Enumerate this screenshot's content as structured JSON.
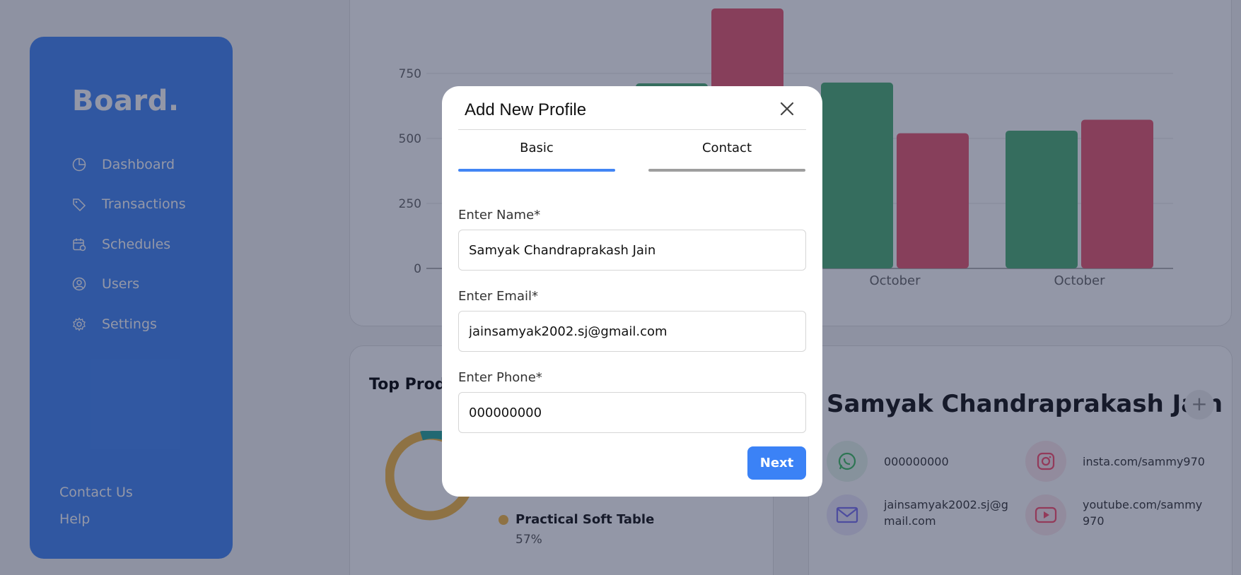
{
  "sidebar": {
    "logo": "Board.",
    "items": [
      {
        "label": "Dashboard",
        "icon": "pie-chart-icon"
      },
      {
        "label": "Transactions",
        "icon": "tag-icon"
      },
      {
        "label": "Schedules",
        "icon": "calendar-clock-icon"
      },
      {
        "label": "Users",
        "icon": "user-circle-icon"
      },
      {
        "label": "Settings",
        "icon": "gear-icon"
      }
    ],
    "footer": [
      "Contact Us",
      "Help"
    ]
  },
  "chart_data": {
    "type": "bar",
    "categories": [
      "",
      "October",
      "October"
    ],
    "series": [
      {
        "values": [
          712,
          715,
          530
        ],
        "color": "#4caf73"
      },
      {
        "values": [
          1000,
          520,
          572
        ],
        "color": "#e8576d"
      }
    ],
    "ylim": [
      0,
      1000
    ],
    "yticks": [
      0,
      250,
      500,
      750
    ]
  },
  "top_products": {
    "title": "Top Prod",
    "legend_name": "Practical Soft Table",
    "legend_pct": "57%"
  },
  "profile_card": {
    "name": "Samyak Chandraprakash Jain",
    "add_symbol": "+",
    "phone": "000000000",
    "email_line1": "jainsamyak2002.sj@g",
    "email_line2": "mail.com",
    "instagram": "insta.com/sammy970",
    "youtube_line1": "youtube.com/sammy",
    "youtube_line2": "970"
  },
  "modal": {
    "title": "Add New Profile",
    "tabs": {
      "basic": "Basic",
      "contact": "Contact"
    },
    "name_label": "Enter Name*",
    "name_value": "Samyak Chandraprakash Jain",
    "email_label": "Enter Email*",
    "email_value": "jainsamyak2002.sj@gmail.com",
    "phone_label": "Enter Phone*",
    "phone_value": "000000000",
    "next_label": "Next"
  },
  "colors": {
    "accent": "#4285f4",
    "bar_green": "#4caf73",
    "bar_red": "#e8576d",
    "overlay": "rgba(30,38,72,0.48)"
  }
}
